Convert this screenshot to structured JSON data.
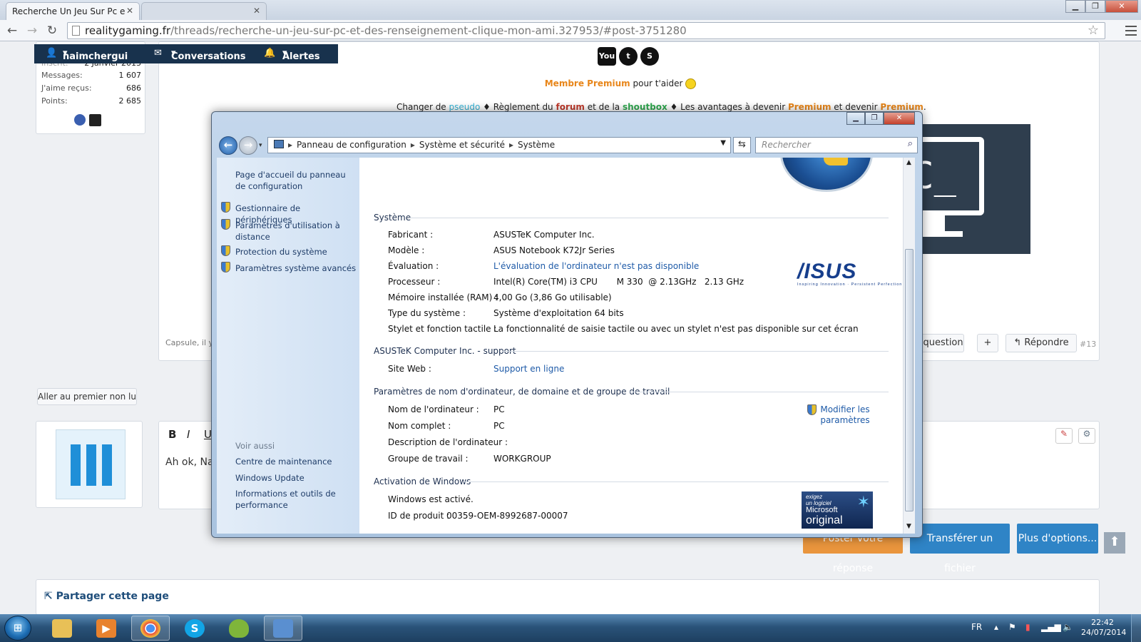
{
  "browser": {
    "tabs": [
      {
        "title": "Recherche Un Jeu Sur Pc e",
        "active": true
      },
      {
        "title": "",
        "active": false
      }
    ],
    "url_host": "realitygaming.fr",
    "url_path": "/threads/recherche-un-jeu-sur-pc-et-des-renseignement-clique-mon-ami.327953/#post-3751280",
    "window_buttons": {
      "minimize": "▁",
      "maximize": "❐",
      "close": "✕"
    }
  },
  "forum": {
    "userbar": {
      "username": "naimchergui",
      "conversations": "Conversations",
      "alerts": "Alertes"
    },
    "stats": [
      {
        "label": "Inscrit:",
        "value": "2 Janvier 2013"
      },
      {
        "label": "Messages:",
        "value": "1 607"
      },
      {
        "label": "J'aime reçus:",
        "value": "686"
      },
      {
        "label": "Points:",
        "value": "2 685"
      }
    ],
    "social": [
      "YouTube",
      "Twitter",
      "Skype"
    ],
    "premium_label": "Membre Premium",
    "premium_text": " pour t'aider",
    "rules": {
      "p1": "Changer de ",
      "pseudo": "pseudo",
      "p2": " ♦ Règlement du ",
      "forum": "forum",
      "p3": " et de la ",
      "shoutbox": "shoutbox",
      "p4": " ♦ Les avantages à devenir ",
      "premium1": "Premium",
      "p5": " et devenir ",
      "premium2": "Premium",
      "p6": "."
    },
    "pc_banner_text": "PC_",
    "post_footer_text": "Capsule, il y",
    "question_label": "a question",
    "plus_label": "+",
    "reply_label": "Répondre",
    "post_number": "#13",
    "first_unread": "Aller au premier non lu",
    "editor": {
      "bold": "B",
      "italic": "I",
      "underline": "U",
      "text": "Ah ok, Nar"
    },
    "post_reply_label": "Poster votre réponse",
    "upload_label": "Transférer un fichier",
    "more_options_label": "Plus d'options...",
    "share_title": "Partager cette page"
  },
  "dialog": {
    "breadcrumb": [
      "Panneau de configuration",
      "Système et sécurité",
      "Système"
    ],
    "search_placeholder": "Rechercher",
    "left_links": {
      "home": "Page d'accueil du panneau de configuration",
      "device_manager": "Gestionnaire de périphériques",
      "remote": "Paramètres d'utilisation à distance",
      "protection": "Protection du système",
      "advanced": "Paramètres système avancés",
      "see_also": "Voir aussi",
      "maintenance": "Centre de maintenance",
      "windows_update": "Windows Update",
      "performance": "Informations et outils de performance"
    },
    "system": {
      "title": "Système",
      "rows": [
        {
          "k": "Fabricant :",
          "v": "ASUSTeK Computer Inc."
        },
        {
          "k": "Modèle :",
          "v": "ASUS Notebook K72Jr Series"
        },
        {
          "k": "Évaluation :",
          "v": "L'évaluation de l'ordinateur n'est pas disponible"
        },
        {
          "k": "Processeur :",
          "v": "Intel(R) Core(TM) i3 CPU       M 330  @ 2.13GHz   2.13 GHz"
        },
        {
          "k": "Mémoire installée (RAM) :",
          "v": "4,00 Go (3,86 Go utilisable)"
        },
        {
          "k": "Type du système :",
          "v": "Système d'exploitation 64 bits"
        },
        {
          "k": "Stylet et fonction tactile :",
          "v": "La fonctionnalité de saisie tactile ou avec un stylet n'est pas disponible sur cet écran"
        }
      ]
    },
    "support": {
      "title": "ASUSTeK Computer Inc. - support",
      "website_label": "Site Web :",
      "website_value": "Support en ligne"
    },
    "computer": {
      "title": "Paramètres de nom d'ordinateur, de domaine et de groupe de travail",
      "modify": "Modifier les paramètres",
      "rows": [
        {
          "k": "Nom de l'ordinateur :",
          "v": "PC"
        },
        {
          "k": "Nom complet :",
          "v": "PC"
        },
        {
          "k": "Description de l'ordinateur :",
          "v": ""
        },
        {
          "k": "Groupe de travail :",
          "v": "WORKGROUP"
        }
      ]
    },
    "activation": {
      "title": "Activation de Windows",
      "status": "Windows est activé.",
      "product_id_label": "ID de produit :",
      "product_id": "00359-OEM-8992687-00007",
      "badge_line1": "exigez",
      "badge_line2": "un logiciel",
      "badge_line3": "Microsoft",
      "badge_line4": "original"
    },
    "asus_logo": "/ISUS",
    "asus_tagline": "Inspiring Innovation · Persistent Perfection"
  },
  "taskbar": {
    "start": "⊞",
    "apps": [
      "explorer",
      "media-player",
      "chrome",
      "skype",
      "game",
      "control-panel"
    ],
    "lang": "FR",
    "time": "22:42",
    "date": "24/07/2014"
  }
}
